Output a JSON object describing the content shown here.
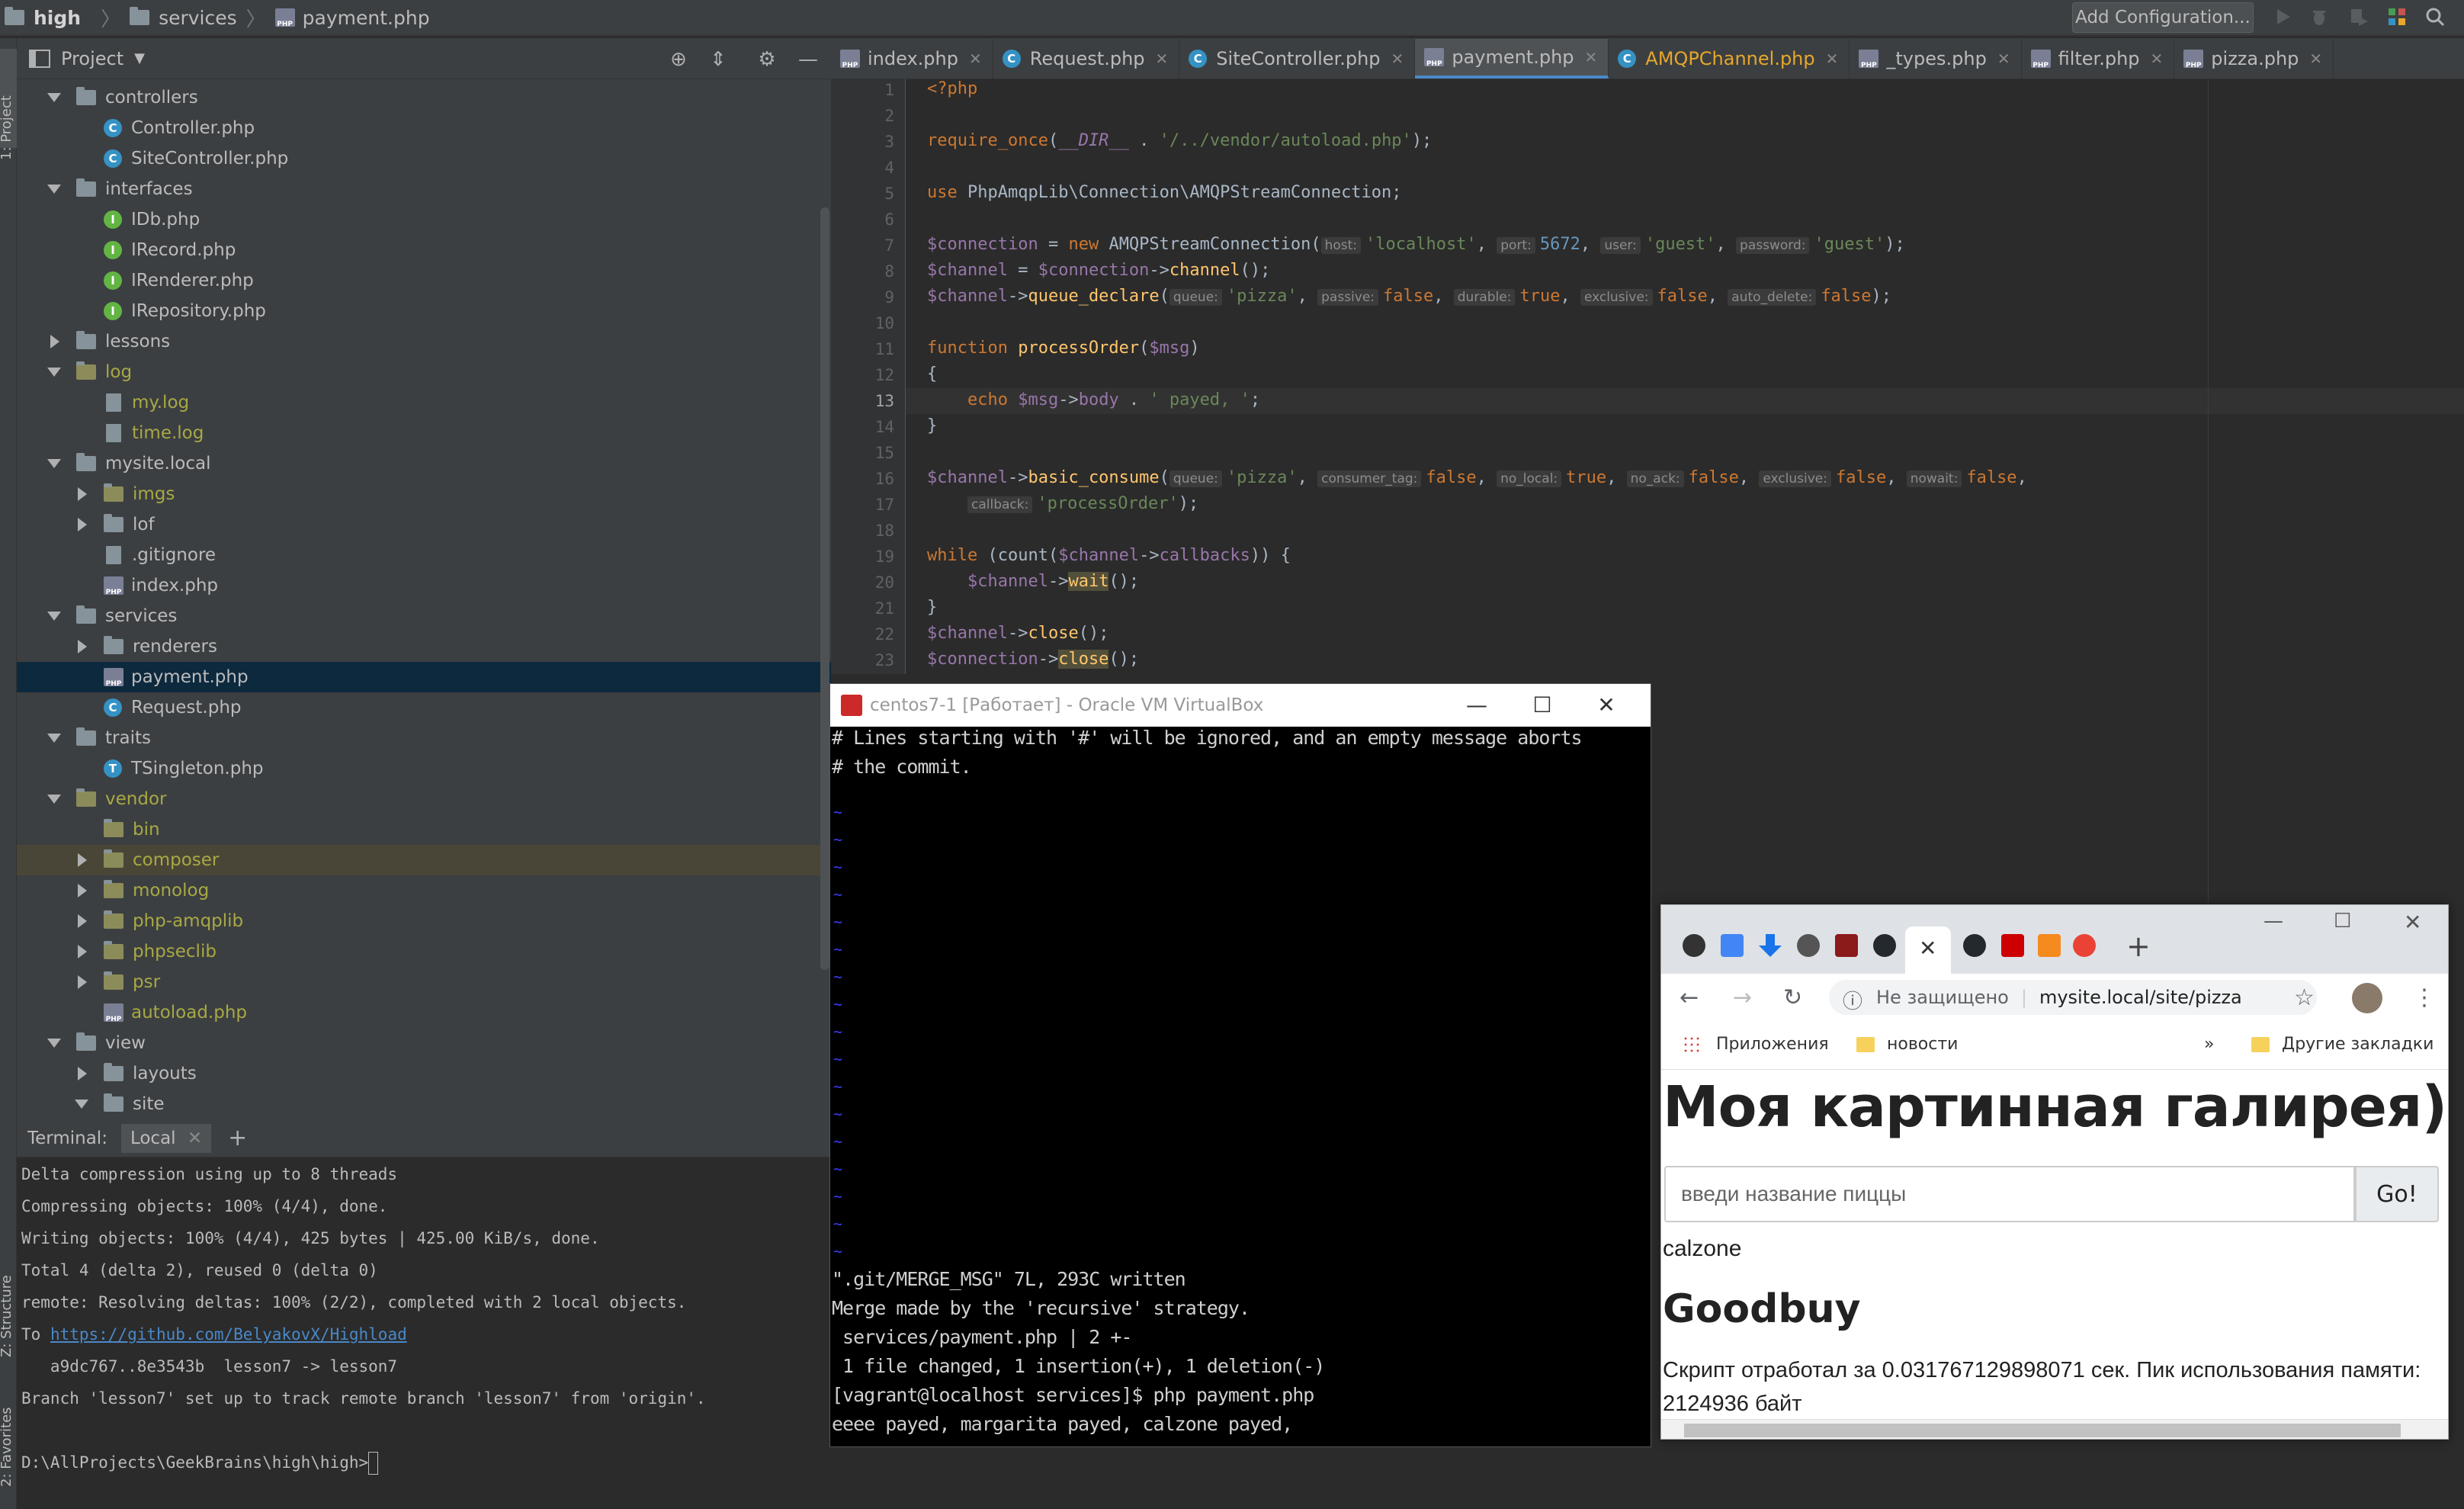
{
  "navbar": {
    "project": "high",
    "folder": "services",
    "file": "payment.php",
    "add_configuration": "Add Configuration..."
  },
  "left_stripe": {
    "project_label": "1: Project",
    "structure_label": "Z: Structure",
    "favorites_label": "2: Favorites"
  },
  "project_panel": {
    "title": "Project",
    "tree": [
      {
        "label": "controllers",
        "type": "folder",
        "depth": 1,
        "arrow": "down"
      },
      {
        "label": "Controller.php",
        "type": "c",
        "depth": 2,
        "arrow": "none"
      },
      {
        "label": "SiteController.php",
        "type": "c",
        "depth": 2,
        "arrow": "none"
      },
      {
        "label": "interfaces",
        "type": "folder",
        "depth": 1,
        "arrow": "down"
      },
      {
        "label": "IDb.php",
        "type": "i",
        "depth": 2,
        "arrow": "none"
      },
      {
        "label": "IRecord.php",
        "type": "i",
        "depth": 2,
        "arrow": "none"
      },
      {
        "label": "IRenderer.php",
        "type": "i",
        "depth": 2,
        "arrow": "none"
      },
      {
        "label": "IRepository.php",
        "type": "i",
        "depth": 2,
        "arrow": "none"
      },
      {
        "label": "lessons",
        "type": "folder",
        "depth": 1,
        "arrow": "right"
      },
      {
        "label": "log",
        "type": "folder",
        "depth": 1,
        "arrow": "down",
        "olive": true
      },
      {
        "label": "my.log",
        "type": "file",
        "depth": 2,
        "arrow": "none",
        "olive": true
      },
      {
        "label": "time.log",
        "type": "file",
        "depth": 2,
        "arrow": "none",
        "olive": true
      },
      {
        "label": "mysite.local",
        "type": "folder",
        "depth": 1,
        "arrow": "down"
      },
      {
        "label": "imgs",
        "type": "folder",
        "depth": 2,
        "arrow": "right",
        "olive": true
      },
      {
        "label": "lof",
        "type": "folder",
        "depth": 2,
        "arrow": "right"
      },
      {
        "label": ".gitignore",
        "type": "file",
        "depth": 2,
        "arrow": "none"
      },
      {
        "label": "index.php",
        "type": "php",
        "depth": 2,
        "arrow": "none"
      },
      {
        "label": "services",
        "type": "folder",
        "depth": 1,
        "arrow": "down"
      },
      {
        "label": "renderers",
        "type": "folder",
        "depth": 2,
        "arrow": "right"
      },
      {
        "label": "payment.php",
        "type": "php",
        "depth": 2,
        "arrow": "none",
        "selected": true
      },
      {
        "label": "Request.php",
        "type": "c",
        "depth": 2,
        "arrow": "none"
      },
      {
        "label": "traits",
        "type": "folder",
        "depth": 1,
        "arrow": "down"
      },
      {
        "label": "TSingleton.php",
        "type": "t",
        "depth": 2,
        "arrow": "none"
      },
      {
        "label": "vendor",
        "type": "folder",
        "depth": 1,
        "arrow": "down",
        "olive": true
      },
      {
        "label": "bin",
        "type": "folder",
        "depth": 2,
        "arrow": "none",
        "olive": true
      },
      {
        "label": "composer",
        "type": "folder",
        "depth": 2,
        "arrow": "right",
        "olive": true,
        "hl": true
      },
      {
        "label": "monolog",
        "type": "folder",
        "depth": 2,
        "arrow": "right",
        "olive": true
      },
      {
        "label": "php-amqplib",
        "type": "folder",
        "depth": 2,
        "arrow": "right",
        "olive": true
      },
      {
        "label": "phpseclib",
        "type": "folder",
        "depth": 2,
        "arrow": "right",
        "olive": true
      },
      {
        "label": "psr",
        "type": "folder",
        "depth": 2,
        "arrow": "right",
        "olive": true
      },
      {
        "label": "autoload.php",
        "type": "php",
        "depth": 2,
        "arrow": "none",
        "olive": true
      },
      {
        "label": "view",
        "type": "folder",
        "depth": 1,
        "arrow": "down"
      },
      {
        "label": "layouts",
        "type": "folder",
        "depth": 2,
        "arrow": "right"
      },
      {
        "label": "site",
        "type": "folder",
        "depth": 2,
        "arrow": "down"
      }
    ]
  },
  "tabs": [
    {
      "label": "index.php",
      "icon": "php"
    },
    {
      "label": "Request.php",
      "icon": "c"
    },
    {
      "label": "SiteController.php",
      "icon": "c"
    },
    {
      "label": "payment.php",
      "icon": "php",
      "active": true
    },
    {
      "label": "AMQPChannel.php",
      "icon": "c",
      "orange": true
    },
    {
      "label": "_types.php",
      "icon": "php"
    },
    {
      "label": "filter.php",
      "icon": "php"
    },
    {
      "label": "pizza.php",
      "icon": "php"
    }
  ],
  "editor": {
    "line_numbers": [
      "1",
      "2",
      "3",
      "4",
      "5",
      "6",
      "7",
      "8",
      "9",
      "10",
      "11",
      "12",
      "13",
      "14",
      "15",
      "16",
      "17",
      "18",
      "19",
      "20",
      "21",
      "22",
      "23"
    ],
    "current_line": 13
  },
  "terminal": {
    "label": "Terminal:",
    "tab": "Local",
    "lines": [
      "Delta compression using up to 8 threads",
      "Compressing objects: 100% (4/4), done.",
      "Writing objects: 100% (4/4), 425 bytes | 425.00 KiB/s, done.",
      "Total 4 (delta 2), reused 0 (delta 0)",
      "remote: Resolving deltas: 100% (2/2), completed with 2 local objects.",
      "   a9dc767..8e3543b  lesson7 -> lesson7",
      "Branch 'lesson7' set up to track remote branch 'lesson7' from 'origin'.",
      "",
      "D:\\AllProjects\\GeekBrains\\high\\high>"
    ],
    "to_prefix": "To ",
    "to_link": "https://github.com/BelyakovX/Highload"
  },
  "vbox": {
    "title": "centos7-1 [Работает] - Oracle VM VirtualBox",
    "top_lines": [
      "# Lines starting with '#' will be ignored, and an empty message aborts",
      "# the commit."
    ],
    "bottom_lines": [
      "\".git/MERGE_MSG\" 7L, 293C written",
      "Merge made by the 'recursive' strategy.",
      " services/payment.php | 2 +-",
      " 1 file changed, 1 insertion(+), 1 deletion(-)",
      "[vagrant@localhost services]$ php payment.php",
      "eeee payed, margarita payed, calzone payed,"
    ]
  },
  "chrome": {
    "url_warning": "Не защищено",
    "url": "mysite.local/site/pizza",
    "bookmarks": {
      "apps": "Приложения",
      "news": "новости",
      "more": "»",
      "other": "Другие закладки"
    },
    "page": {
      "heading": "Моя картинная галирея))",
      "search_placeholder": "введи название пиццы",
      "go": "Go!",
      "result": "calzone",
      "goodbuy": "Goodbuy",
      "script_info": "Скрипт отработал за 0.031767129898071 сек. Пик использования памяти: 2124936 байт"
    }
  }
}
